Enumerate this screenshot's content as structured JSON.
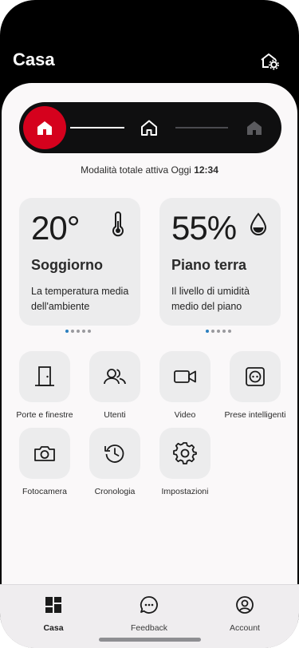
{
  "header": {
    "title": "Casa",
    "settings_icon": "home-gear-icon"
  },
  "mode_selector": {
    "modes": [
      {
        "icon": "home-filled-icon",
        "state": "active"
      },
      {
        "icon": "home-outline-icon",
        "state": "available"
      },
      {
        "icon": "home-disabled-icon",
        "state": "inactive"
      }
    ],
    "accent_color": "#d5011d"
  },
  "status": {
    "text": "Modalità totale attiva Oggi",
    "time": "12:34"
  },
  "cards": [
    {
      "value": "20°",
      "name": "Soggiorno",
      "description": "La temperatura media dell'ambiente",
      "icon": "thermometer-icon",
      "pager_dots": 5,
      "active_dot": 0
    },
    {
      "value": "55%",
      "name": "Piano terra",
      "description": "Il livello di umidità medio del piano",
      "icon": "humidity-drop-icon",
      "pager_dots": 5,
      "active_dot": 0
    }
  ],
  "tiles": [
    {
      "label": "Porte e finestre",
      "icon": "door-icon"
    },
    {
      "label": "Utenti",
      "icon": "users-icon"
    },
    {
      "label": "Video",
      "icon": "video-camera-icon"
    },
    {
      "label": "Prese intelligenti",
      "icon": "smart-plug-icon"
    },
    {
      "label": "Fotocamera",
      "icon": "camera-icon"
    },
    {
      "label": "Cronologia",
      "icon": "history-icon"
    },
    {
      "label": "Impostazioni",
      "icon": "gear-icon"
    }
  ],
  "tabbar": {
    "items": [
      {
        "label": "Casa",
        "icon": "dashboard-icon",
        "active": true
      },
      {
        "label": "Feedback",
        "icon": "chat-bubble-icon",
        "active": false
      },
      {
        "label": "Account",
        "icon": "account-icon",
        "active": false
      }
    ]
  }
}
